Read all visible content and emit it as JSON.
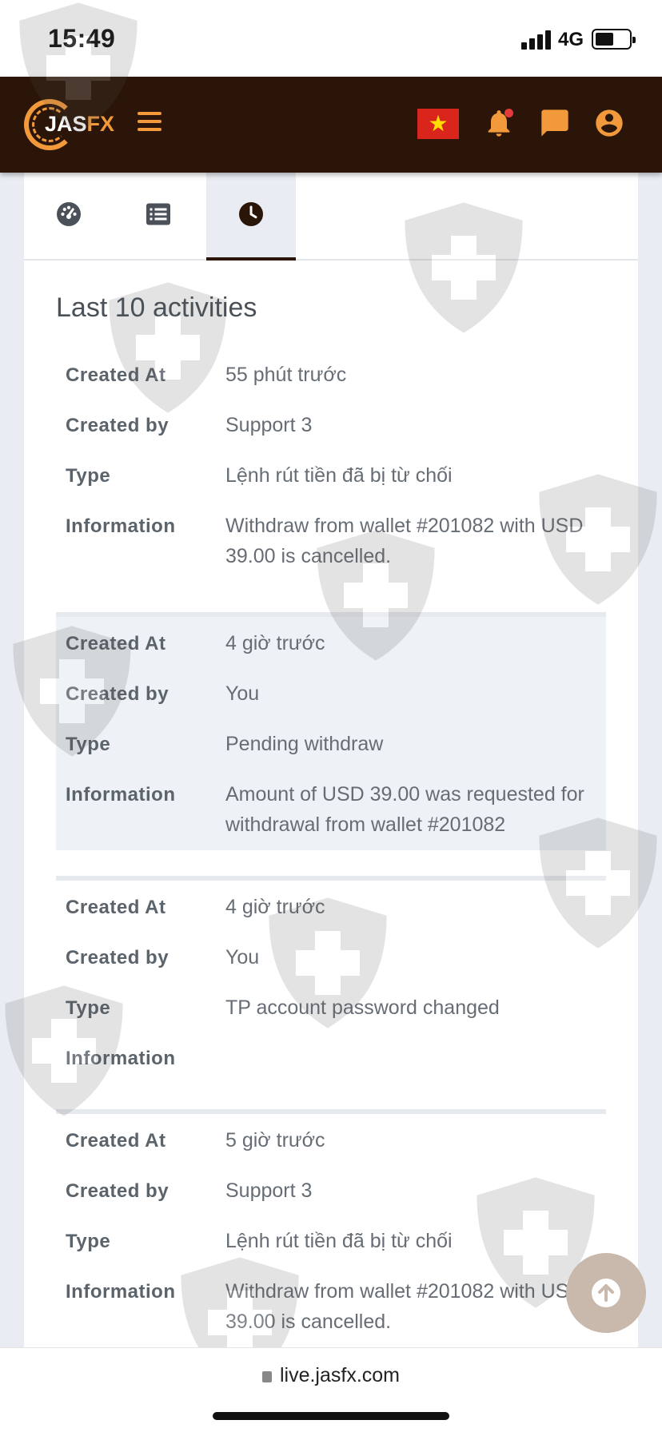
{
  "status_bar": {
    "time": "15:49",
    "network": "4G"
  },
  "header": {
    "logo_text_white": "JAS",
    "logo_text_accent": "FX",
    "colors": {
      "bar": "#2a1508",
      "accent": "#f29a3b"
    },
    "icons": [
      "menu-icon",
      "vietnam-flag-icon",
      "bell-icon",
      "chat-icon",
      "user-icon"
    ]
  },
  "tabs": [
    {
      "icon": "dashboard-icon",
      "active": false
    },
    {
      "icon": "list-icon",
      "active": false
    },
    {
      "icon": "clock-icon",
      "active": true
    }
  ],
  "section_title": "Last 10 activities",
  "labels": {
    "created_at": "Created At",
    "created_by": "Created by",
    "type": "Type",
    "information": "Information"
  },
  "activities": [
    {
      "created_at": "55 phút trước",
      "created_by": "Support 3",
      "type": "Lệnh rút tiền đã bị từ chối",
      "information": "Withdraw from wallet #201082 with USD 39.00 is cancelled."
    },
    {
      "created_at": "4 giờ trước",
      "created_by": "You",
      "type": "Pending withdraw",
      "information": "Amount of USD 39.00 was requested for withdrawal from wallet #201082"
    },
    {
      "created_at": "4 giờ trước",
      "created_by": "You",
      "type": "TP account password changed",
      "information": ""
    },
    {
      "created_at": "5 giờ trước",
      "created_by": "Support 3",
      "type": "Lệnh rút tiền đã bị từ chối",
      "information": "Withdraw from wallet #201082 with USD 39.00 is cancelled."
    }
  ],
  "browser": {
    "url": "live.jasfx.com"
  }
}
